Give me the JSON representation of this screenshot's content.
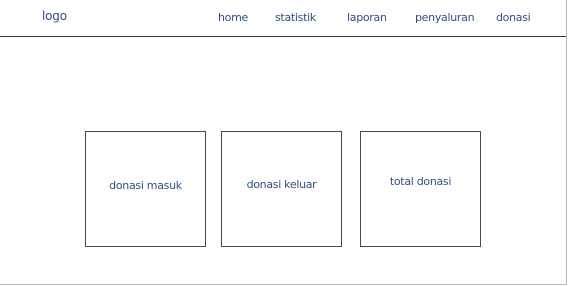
{
  "header": {
    "logo": "logo",
    "nav": {
      "home": "home",
      "statistik": "statistik",
      "laporan": "laporan",
      "penyaluran": "penyaluran",
      "donasi": "donasi"
    }
  },
  "cards": {
    "masuk": "donasi masuk",
    "keluar": "donasi keluar",
    "total": "total donasi"
  },
  "colors": {
    "text": "#2e4f86",
    "border": "#4a4a4a",
    "background": "#ffffff"
  }
}
